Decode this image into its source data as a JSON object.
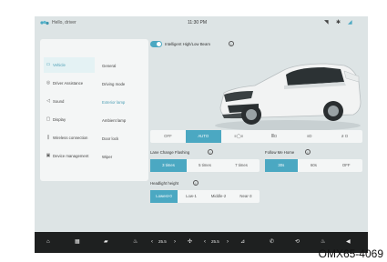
{
  "status": {
    "user_name": "Hello, driver",
    "time": "11:30 PM"
  },
  "toggle": {
    "label": "Intelligent High/Low Beam",
    "on": true
  },
  "categories": [
    {
      "label": "Vehicle",
      "icon": "car-icon",
      "active": true
    },
    {
      "label": "Driver Assistance",
      "icon": "steering-icon",
      "active": false
    },
    {
      "label": "Sound",
      "icon": "speaker-icon",
      "active": false
    },
    {
      "label": "Display",
      "icon": "display-icon",
      "active": false
    },
    {
      "label": "Wireless connection",
      "icon": "wireless-icon",
      "active": false
    },
    {
      "label": "Device management",
      "icon": "device-icon",
      "active": false
    }
  ],
  "subitems": [
    {
      "label": "General",
      "active": false
    },
    {
      "label": "Driving mode",
      "active": false
    },
    {
      "label": "Exterior lamp",
      "active": true
    },
    {
      "label": "Ambient lamp",
      "active": false
    },
    {
      "label": "Door lock",
      "active": false
    },
    {
      "label": "Wiper",
      "active": false
    }
  ],
  "modes": [
    "OFF",
    "AUTO",
    "parking-lamp-icon",
    "low-beam-icon",
    "high-beam-icon",
    "fog-lamp-icon"
  ],
  "mode_active": "AUTO",
  "lane_change": {
    "title": "Lane Change Flashing",
    "options": [
      "3 times",
      "5 times",
      "7 times"
    ],
    "active": "3 times"
  },
  "follow_me_home": {
    "title": "Follow Me Home",
    "options": [
      "30s",
      "60s",
      "OFF"
    ],
    "active": "30s"
  },
  "headlight_height": {
    "title": "Headlight height",
    "options": [
      "Lowest-0",
      "Low-1",
      "Middle-2",
      "Near-3"
    ],
    "active": "Lowest-0"
  },
  "dock": {
    "temp_left": "25.5",
    "temp_right": "25.5"
  },
  "caption": "OMX65-4069",
  "colors": {
    "accent": "#4ba8c2",
    "screen_bg": "#dde4e5",
    "panel_bg": "#f4f6f6",
    "dock_bg": "#1e2020"
  }
}
